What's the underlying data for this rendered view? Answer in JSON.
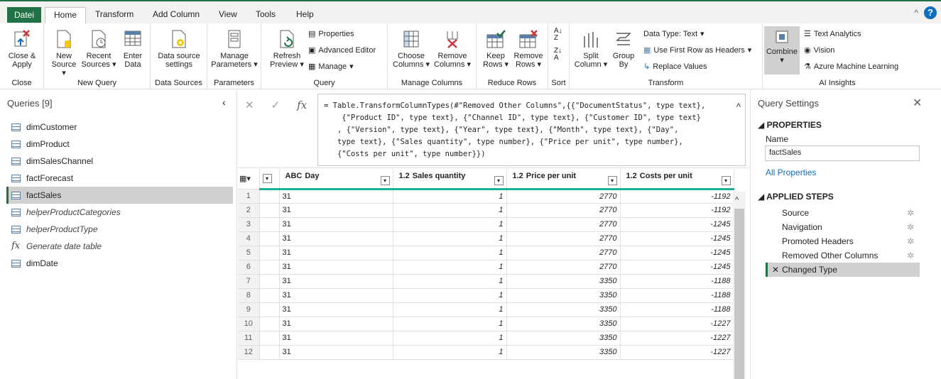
{
  "tabs": [
    "Datei",
    "Home",
    "Transform",
    "Add Column",
    "View",
    "Tools",
    "Help"
  ],
  "ribbon": {
    "close_apply": [
      "Close &",
      "Apply"
    ],
    "new_source": [
      "New",
      "Source"
    ],
    "recent_sources": [
      "Recent",
      "Sources"
    ],
    "enter_data": [
      "Enter",
      "Data"
    ],
    "data_source_settings": [
      "Data source",
      "settings"
    ],
    "manage_parameters": [
      "Manage",
      "Parameters"
    ],
    "refresh_preview": [
      "Refresh",
      "Preview"
    ],
    "properties": "Properties",
    "advanced_editor": "Advanced Editor",
    "manage": "Manage",
    "choose_columns": [
      "Choose",
      "Columns"
    ],
    "remove_columns": [
      "Remove",
      "Columns"
    ],
    "keep_rows": [
      "Keep",
      "Rows"
    ],
    "remove_rows": [
      "Remove",
      "Rows"
    ],
    "split_column": [
      "Split",
      "Column"
    ],
    "group_by": [
      "Group",
      "By"
    ],
    "data_type": "Data Type: Text",
    "first_row_headers": "Use First Row as Headers",
    "replace_values": "Replace Values",
    "combine": "Combine",
    "text_analytics": "Text Analytics",
    "vision": "Vision",
    "azure_ml": "Azure Machine Learning",
    "groups": [
      "Close",
      "New Query",
      "Data Sources",
      "Parameters",
      "Query",
      "Manage Columns",
      "Reduce Rows",
      "Sort",
      "Transform",
      "AI Insights"
    ]
  },
  "queries": {
    "title": "Queries [9]",
    "items": [
      {
        "label": "dimCustomer",
        "kind": "table"
      },
      {
        "label": "dimProduct",
        "kind": "table"
      },
      {
        "label": "dimSalesChannel",
        "kind": "table"
      },
      {
        "label": "factForecast",
        "kind": "table"
      },
      {
        "label": "factSales",
        "kind": "table"
      },
      {
        "label": "helperProductCategories",
        "kind": "table"
      },
      {
        "label": "helperProductType",
        "kind": "table"
      },
      {
        "label": "Generate date table",
        "kind": "function"
      },
      {
        "label": "dimDate",
        "kind": "table"
      }
    ]
  },
  "formula": {
    "lines": [
      "= Table.TransformColumnTypes(#\"Removed Other Columns\",{{\"DocumentStatus\", type text},",
      "    {\"Product ID\", type text}, {\"Channel ID\", type text}, {\"Customer ID\", type text}",
      "   , {\"Version\", type text}, {\"Year\", type text}, {\"Month\", type text}, {\"Day\",",
      "   type text}, {\"Sales quantity\", type number}, {\"Price per unit\", type number},",
      "   {\"Costs per unit\", type number}})"
    ]
  },
  "grid": {
    "columns": [
      {
        "name": "Day",
        "type": "ABC"
      },
      {
        "name": "Sales quantity",
        "type": "1.2"
      },
      {
        "name": "Price per unit",
        "type": "1.2"
      },
      {
        "name": "Costs per unit",
        "type": "1.2"
      }
    ],
    "rows": [
      [
        "1",
        "31",
        "1",
        "2770",
        "-1192"
      ],
      [
        "2",
        "31",
        "1",
        "2770",
        "-1192"
      ],
      [
        "3",
        "31",
        "1",
        "2770",
        "-1245"
      ],
      [
        "4",
        "31",
        "1",
        "2770",
        "-1245"
      ],
      [
        "5",
        "31",
        "1",
        "2770",
        "-1245"
      ],
      [
        "6",
        "31",
        "1",
        "2770",
        "-1245"
      ],
      [
        "7",
        "31",
        "1",
        "3350",
        "-1188"
      ],
      [
        "8",
        "31",
        "1",
        "3350",
        "-1188"
      ],
      [
        "9",
        "31",
        "1",
        "3350",
        "-1188"
      ],
      [
        "10",
        "31",
        "1",
        "3350",
        "-1227"
      ],
      [
        "11",
        "31",
        "1",
        "3350",
        "-1227"
      ],
      [
        "12",
        "31",
        "1",
        "3350",
        "-1227"
      ]
    ]
  },
  "settings": {
    "title": "Query Settings",
    "properties": "PROPERTIES",
    "name_label": "Name",
    "name_value": "factSales",
    "all_properties": "All Properties",
    "applied_steps": "APPLIED STEPS",
    "steps": [
      "Source",
      "Navigation",
      "Promoted Headers",
      "Removed Other Columns",
      "Changed Type"
    ]
  }
}
